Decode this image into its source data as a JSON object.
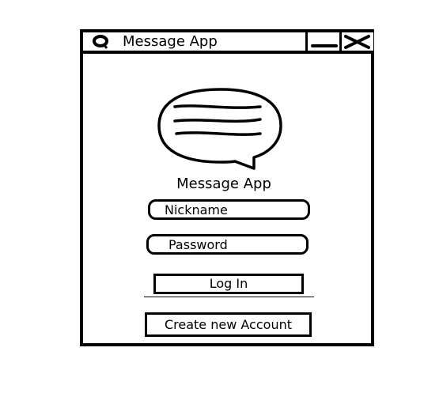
{
  "window": {
    "title": "Message App",
    "icon": "chat-bubble-icon",
    "controls": {
      "minimize_icon": "minimize-icon",
      "close_icon": "close-icon"
    }
  },
  "main": {
    "logo_icon": "chat-bubble-icon",
    "heading": "Message App",
    "nickname": {
      "value": "",
      "placeholder": "Nickname"
    },
    "password": {
      "value": "",
      "placeholder": "Password"
    },
    "login_label": "Log In",
    "create_account_label": "Create new Account"
  },
  "colors": {
    "stroke": "#000000",
    "background": "#ffffff"
  }
}
